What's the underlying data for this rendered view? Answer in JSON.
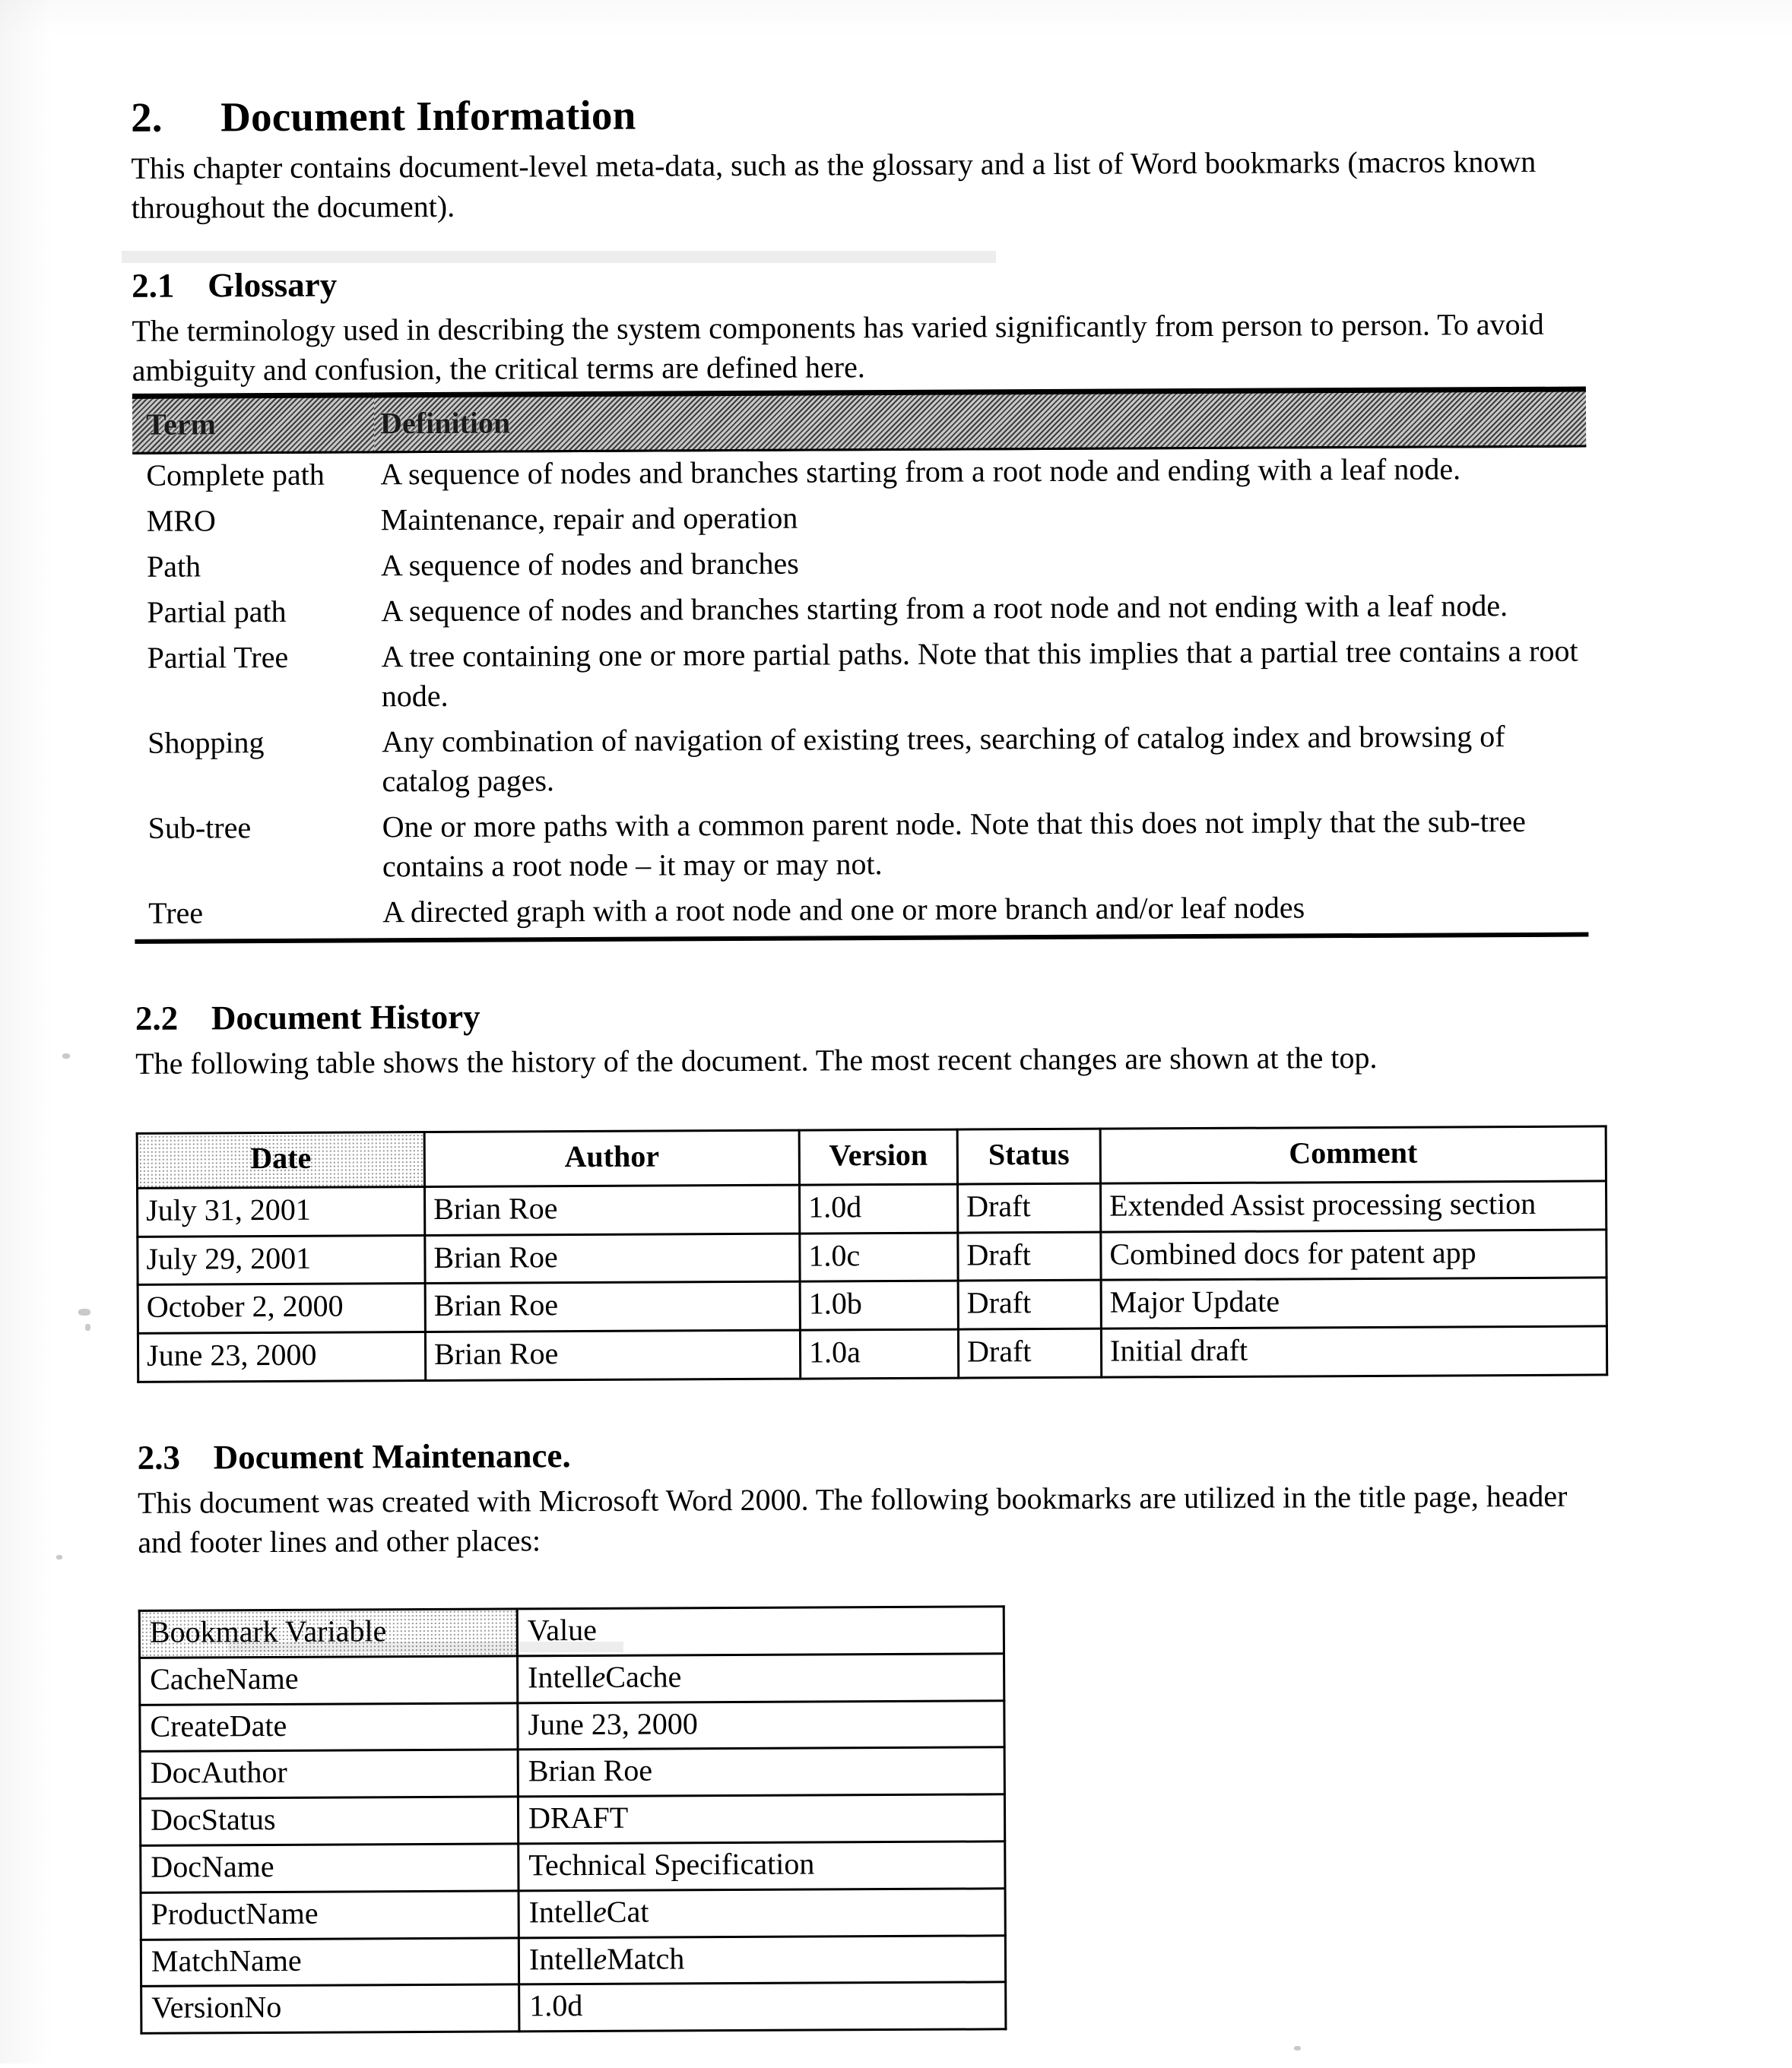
{
  "chapter": {
    "number": "2.",
    "title": "Document Information",
    "intro": "This chapter contains document-level meta-data, such as the glossary and a list of Word bookmarks (macros known throughout the document)."
  },
  "glossary_section": {
    "number": "2.1",
    "title": "Glossary",
    "intro": "The terminology used in describing the system components has varied significantly from person to person.  To avoid ambiguity and confusion, the critical terms are defined here.",
    "table": {
      "headers": [
        "Term",
        "Definition"
      ],
      "rows": [
        [
          "Complete path",
          "A sequence of nodes and branches starting from a root node and ending with a leaf node."
        ],
        [
          "MRO",
          "Maintenance, repair and operation"
        ],
        [
          "Path",
          "A sequence of nodes and branches"
        ],
        [
          "Partial path",
          "A sequence of nodes and branches starting from a root node and not ending with a leaf node."
        ],
        [
          "Partial Tree",
          "A tree containing one or more partial paths.  Note that this implies that a partial tree contains a root node."
        ],
        [
          "Shopping",
          "Any combination of navigation of existing trees, searching of catalog index and browsing of catalog pages."
        ],
        [
          "Sub-tree",
          "One or more paths with a common parent node.  Note that this does not imply that the sub-tree contains a root node – it may or may not."
        ],
        [
          "Tree",
          "A directed graph with a root node and one or more branch and/or leaf nodes"
        ]
      ]
    }
  },
  "history_section": {
    "number": "2.2",
    "title": "Document History",
    "intro": "The following table shows the history of the document.  The most recent changes are shown at the top.",
    "table": {
      "headers": [
        "Date",
        "Author",
        "Version",
        "Status",
        "Comment"
      ],
      "rows": [
        [
          "July 31, 2001",
          "Brian Roe",
          "1.0d",
          "Draft",
          "Extended Assist processing section"
        ],
        [
          "July 29, 2001",
          "Brian Roe",
          "1.0c",
          "Draft",
          "Combined docs for patent app"
        ],
        [
          "October 2, 2000",
          "Brian Roe",
          "1.0b",
          "Draft",
          "Major Update"
        ],
        [
          "June 23, 2000",
          "Brian Roe",
          "1.0a",
          "Draft",
          "Initial draft"
        ]
      ]
    }
  },
  "maintenance_section": {
    "number": "2.3",
    "title": "Document Maintenance.",
    "intro": "This document was created with Microsoft Word 2000. The following bookmarks are utilized in the title page, header and footer lines and other places:",
    "table": {
      "headers": [
        "Bookmark Variable",
        "Value"
      ],
      "rows": [
        {
          "variable": "CacheName",
          "value_pre": "Intell",
          "value_em": "e",
          "value_post": "Cache"
        },
        {
          "variable": "CreateDate",
          "value_pre": "June 23, 2000",
          "value_em": "",
          "value_post": ""
        },
        {
          "variable": "DocAuthor",
          "value_pre": "Brian Roe",
          "value_em": "",
          "value_post": ""
        },
        {
          "variable": "DocStatus",
          "value_pre": "DRAFT",
          "value_em": "",
          "value_post": ""
        },
        {
          "variable": "DocName",
          "value_pre": "Technical Specification",
          "value_em": "",
          "value_post": ""
        },
        {
          "variable": "ProductName",
          "value_pre": "Intell",
          "value_em": "e",
          "value_post": "Cat"
        },
        {
          "variable": "MatchName",
          "value_pre": "Intell",
          "value_em": "e",
          "value_post": "Match"
        },
        {
          "variable": "VersionNo",
          "value_pre": "1.0d",
          "value_em": "",
          "value_post": ""
        }
      ]
    }
  }
}
